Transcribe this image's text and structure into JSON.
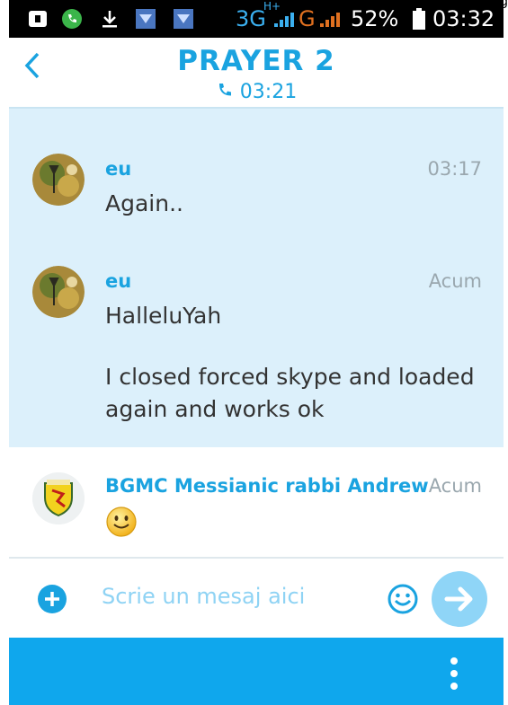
{
  "status_bar": {
    "network": "3G",
    "network_sub": "H+",
    "network2": "G",
    "battery": "52%",
    "clock": "03:32"
  },
  "header": {
    "title": "PRAYER 2",
    "call_time": "03:21"
  },
  "messages": [
    {
      "sender": "eu",
      "time": "03:17",
      "lines": [
        "Again.."
      ]
    },
    {
      "sender": "eu",
      "time": "Acum",
      "lines": [
        "HalleluYah",
        "",
        "I closed forced skype and loaded",
        "again and works ok"
      ]
    },
    {
      "sender": "BGMC Messianic rabbi Andrew",
      "time": "Acum",
      "lines": []
    }
  ],
  "composer": {
    "placeholder": "Scrie un mesaj aici"
  },
  "colors": {
    "accent": "#1aa3e0",
    "bubble_bg": "#dcf0fb",
    "bottom_bar": "#0fa7ed"
  },
  "corner_fragment": "pag"
}
